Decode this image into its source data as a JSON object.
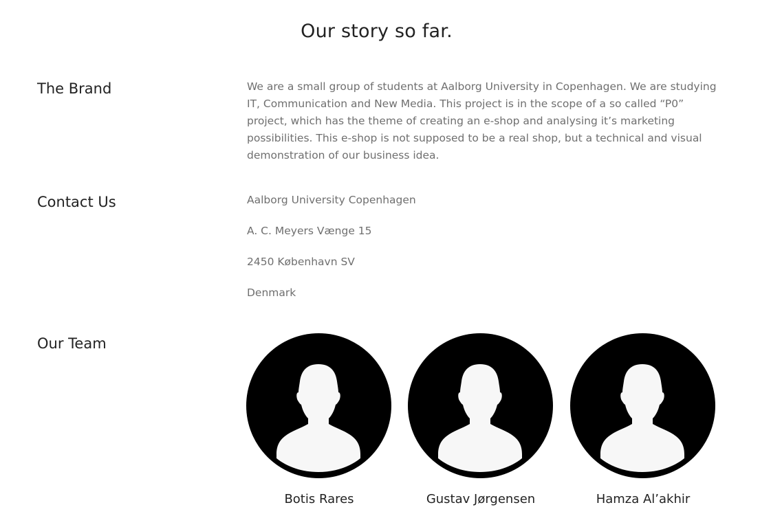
{
  "page": {
    "title": "Our story so far."
  },
  "brand": {
    "heading": "The Brand",
    "text": "We are a small group of students at Aalborg University in Copenhagen. We are studying IT, Communication and New Media. This project is in the scope of a so called “P0” project, which has the theme of creating an e-shop and analysing it’s marketing possibilities. This e-shop is not supposed to be a real shop, but a technical and visual demonstration of our business idea."
  },
  "contact": {
    "heading": "Contact Us",
    "lines": [
      "Aalborg University Copenhagen",
      "A. C. Meyers Vænge 15",
      "2450 København SV",
      "Denmark"
    ]
  },
  "team": {
    "heading": "Our Team",
    "avatar_icon": "person-silhouette-icon",
    "members": [
      {
        "name": "Botis Rares"
      },
      {
        "name": "Gustav Jørgensen"
      },
      {
        "name": "Hamza Al’akhir"
      }
    ]
  },
  "colors": {
    "heading": "#222222",
    "body_text": "#6f6f6f",
    "avatar_bg": "#000000",
    "avatar_fg": "#f7f7f7"
  }
}
